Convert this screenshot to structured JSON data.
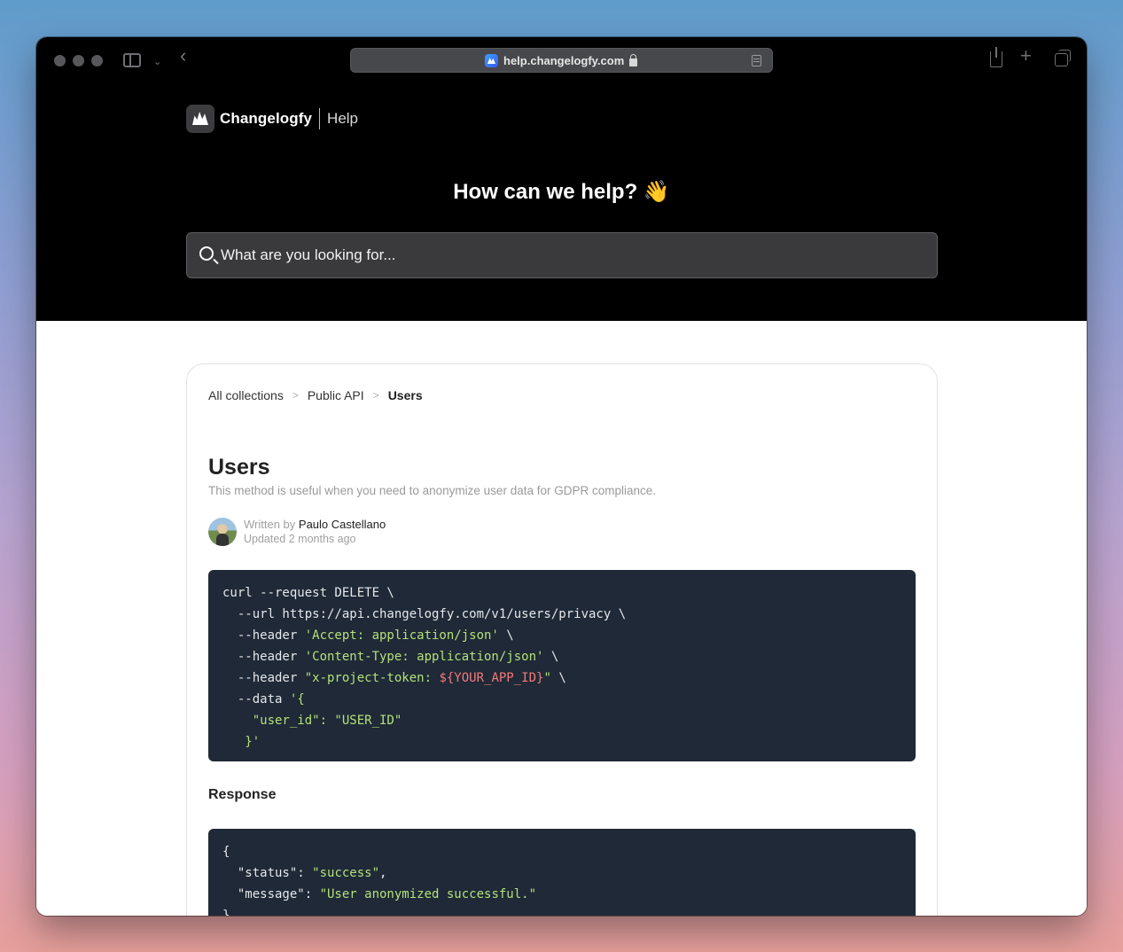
{
  "browser": {
    "url": "help.changelogfy.com"
  },
  "brand": {
    "name": "Changelogfy",
    "section": "Help"
  },
  "hero": {
    "title": "How can we help? 👋",
    "search_placeholder": "What are you looking for..."
  },
  "breadcrumb": {
    "items": [
      "All collections",
      "Public API",
      "Users"
    ]
  },
  "article": {
    "title": "Users",
    "description": "This method is useful when you need to anonymize user data for GDPR compliance.",
    "written_by_label": "Written by",
    "author": "Paulo Castellano",
    "updated": "Updated 2 months ago",
    "response_heading": "Response"
  },
  "code_request": {
    "lines": [
      [
        {
          "t": "curl --request DELETE \\",
          "c": "plain"
        }
      ],
      [
        {
          "t": "  --url https://api.changelogfy.com/v1/users/privacy \\",
          "c": "plain"
        }
      ],
      [
        {
          "t": "  --header ",
          "c": "plain"
        },
        {
          "t": "'Accept: application/json'",
          "c": "str"
        },
        {
          "t": " \\",
          "c": "plain"
        }
      ],
      [
        {
          "t": "  --header ",
          "c": "plain"
        },
        {
          "t": "'Content-Type: application/json'",
          "c": "str"
        },
        {
          "t": " \\",
          "c": "plain"
        }
      ],
      [
        {
          "t": "  --header ",
          "c": "plain"
        },
        {
          "t": "\"x-project-token: ",
          "c": "str"
        },
        {
          "t": "${YOUR_APP_ID}",
          "c": "var"
        },
        {
          "t": "\"",
          "c": "str"
        },
        {
          "t": " \\",
          "c": "plain"
        }
      ],
      [
        {
          "t": "  --data ",
          "c": "plain"
        },
        {
          "t": "'{",
          "c": "str"
        }
      ],
      [
        {
          "t": "    \"user_id\": \"USER_ID\"",
          "c": "str"
        }
      ],
      [
        {
          "t": "   }'",
          "c": "str"
        }
      ]
    ]
  },
  "code_response": {
    "lines": [
      [
        {
          "t": "{",
          "c": "plain"
        }
      ],
      [
        {
          "t": "  \"status\": ",
          "c": "plain"
        },
        {
          "t": "\"success\"",
          "c": "str"
        },
        {
          "t": ",",
          "c": "plain"
        }
      ],
      [
        {
          "t": "  \"message\": ",
          "c": "plain"
        },
        {
          "t": "\"User anonymized successful.\"",
          "c": "str"
        }
      ],
      [
        {
          "t": "}",
          "c": "plain"
        }
      ]
    ]
  }
}
